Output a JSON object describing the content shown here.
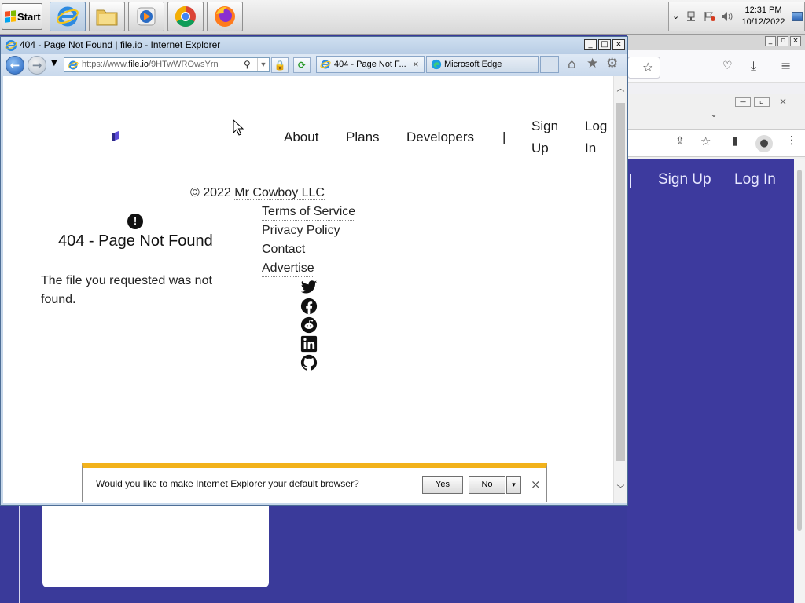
{
  "taskbar": {
    "start_label": "Start",
    "apps": [
      {
        "name": "internet-explorer",
        "icon": "ie-icon"
      },
      {
        "name": "file-explorer",
        "icon": "folder-icon"
      },
      {
        "name": "media-player",
        "icon": "media-player-icon"
      },
      {
        "name": "chrome",
        "icon": "chrome-icon"
      },
      {
        "name": "firefox",
        "icon": "firefox-icon"
      }
    ],
    "clock_time": "12:31 PM",
    "clock_date": "10/12/2022"
  },
  "ie": {
    "window_title": "404 - Page Not Found | file.io - Internet Explorer",
    "address_prefix": "https://www.",
    "address_host": "file.io",
    "address_path": "/9HTwWROwsYrn",
    "tabs": [
      {
        "label": "404 - Page Not F...",
        "close": "×"
      },
      {
        "label": "Microsoft Edge"
      }
    ]
  },
  "page": {
    "nav": {
      "about": "About",
      "plans": "Plans",
      "developers": "Developers",
      "separator": "|",
      "sign_up_1": "Sign",
      "sign_up_2": "Up",
      "log_in_1": "Log",
      "log_in_2": "In"
    },
    "copyright_prefix": "© 2022",
    "copyright_company": "Mr Cowboy LLC",
    "footer_links": [
      "Terms of Service",
      "Privacy Policy",
      "Contact",
      "Advertise"
    ],
    "social_icons": [
      "twitter-icon",
      "facebook-icon",
      "reddit-icon",
      "linkedin-icon",
      "github-icon"
    ],
    "alert_symbol": "!",
    "error_title": "404 - Page Not Found",
    "error_message": "The file you requested was not found."
  },
  "notification": {
    "text": "Would you like to make Internet Explorer your default browser?",
    "yes_label": "Yes",
    "no_label": "No",
    "dropdown": "▾",
    "close": "×"
  },
  "firefox": {
    "nav_sign_up": "Sign Up",
    "nav_log_in": "Log In",
    "separator": "|"
  },
  "colors": {
    "ie_chrome": "#c6d7ea",
    "notify_accent": "#f2b21b",
    "fileio_purple": "#3d3a9e",
    "logo_purple": "#5b4bd6"
  }
}
